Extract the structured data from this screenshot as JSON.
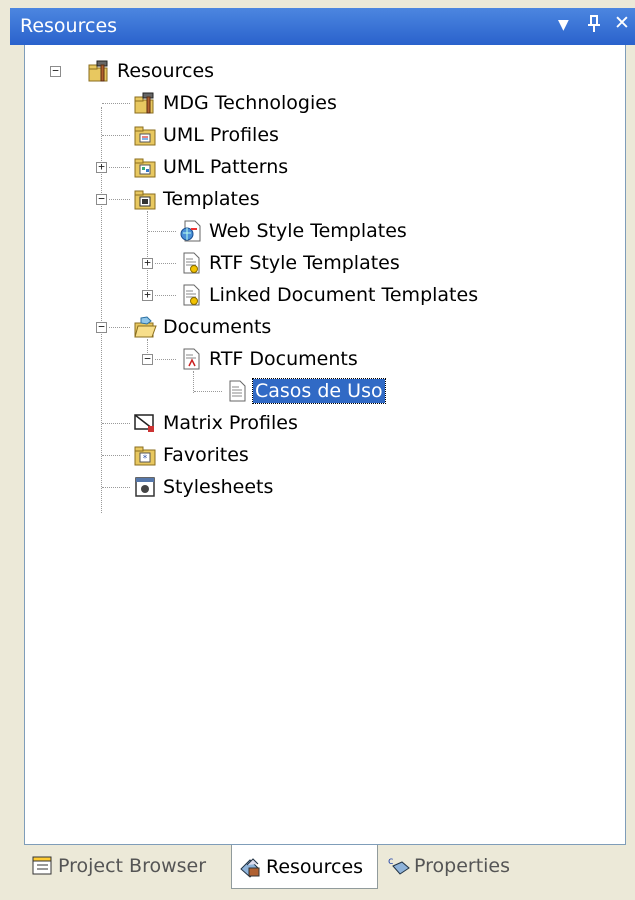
{
  "window": {
    "title": "Resources",
    "controls": {
      "dropdown": "▼",
      "pin": "ᵽ",
      "close": "✕"
    }
  },
  "tree": {
    "root": "Resources",
    "mdg": "MDG Technologies",
    "uml_profiles": "UML Profiles",
    "uml_patterns": "UML Patterns",
    "templates": "Templates",
    "web_style": "Web Style Templates",
    "rtf_style": "RTF Style Templates",
    "linked_doc": "Linked Document Templates",
    "documents": "Documents",
    "rtf_documents": "RTF Documents",
    "casos_de_uso": "Casos de Uso",
    "matrix_profiles": "Matrix Profiles",
    "favorites": "Favorites",
    "stylesheets": "Stylesheets"
  },
  "tabs": {
    "project_browser": "Project Browser",
    "resources": "Resources",
    "properties": "Properties"
  },
  "colors": {
    "title_bar": "#2a62cc",
    "selection": "#316ac5"
  }
}
